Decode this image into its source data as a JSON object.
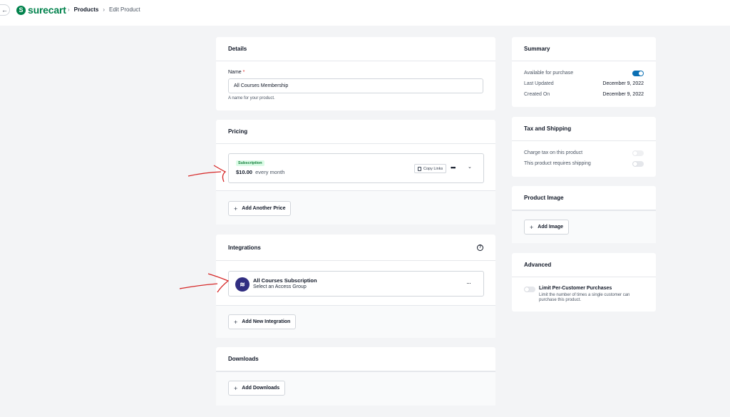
{
  "header": {
    "back_icon": "arrow-left-icon",
    "logo_text": "surecart",
    "breadcrumb": {
      "products": "Products",
      "current": "Edit Product"
    }
  },
  "details": {
    "title": "Details",
    "name_label": "Name",
    "required_mark": "*",
    "name_value": "All Courses Membership",
    "name_help": "A name for your product."
  },
  "pricing": {
    "title": "Pricing",
    "badge": "Subscription",
    "amount": "$10.00",
    "interval": "every month",
    "copy_links": "Copy Links",
    "more": "•••",
    "add_price": "Add Another Price"
  },
  "integrations": {
    "title": "Integrations",
    "item_title": "All Courses Subscription",
    "item_sub": "Select an Access Group",
    "more": "···",
    "add_integration": "Add New Integration"
  },
  "downloads": {
    "title": "Downloads",
    "add_downloads": "Add Downloads"
  },
  "summary": {
    "title": "Summary",
    "available_label": "Available for purchase",
    "available_on": true,
    "last_updated_label": "Last Updated",
    "last_updated_value": "December 9, 2022",
    "created_label": "Created On",
    "created_value": "December 9, 2022"
  },
  "tax_shipping": {
    "title": "Tax and Shipping",
    "charge_tax": "Charge tax on this product",
    "requires_shipping": "This product requires shipping"
  },
  "product_image": {
    "title": "Product Image",
    "add_image": "Add Image"
  },
  "advanced": {
    "title": "Advanced",
    "limit_title": "Limit Per-Customer Purchases",
    "limit_desc": "Limit the number of times a single customer can purchase this product."
  },
  "colors": {
    "brand_green": "#01824c",
    "toggle_on": "#0b6fb3",
    "annotation_red": "#d62828"
  }
}
